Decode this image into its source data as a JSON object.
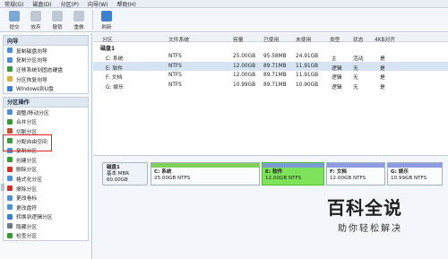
{
  "menu": [
    "常规(G)",
    "磁盘(D)",
    "分区(P)",
    "向导(W)",
    "帮助(H)"
  ],
  "toolbar": [
    {
      "label": "提交",
      "color": "#7aa7d6"
    },
    {
      "label": "放弃",
      "color": "#bfc9d6"
    },
    {
      "label": "撤销",
      "color": "#bfc9d6"
    },
    {
      "label": "重做",
      "color": "#bfc9d6"
    },
    {
      "label": "刷新",
      "color": "#3f7fd0"
    }
  ],
  "wizard": {
    "title": "向导",
    "items": [
      {
        "label": "复制磁盘向导",
        "icon": "copy-disk-icon",
        "color": "#4f8fd6"
      },
      {
        "label": "复制分区向导",
        "icon": "copy-partition-icon",
        "color": "#4f8fd6"
      },
      {
        "label": "迁移系统到固态硬盘",
        "icon": "migrate-icon",
        "color": "#3a9a3a"
      },
      {
        "label": "分区恢复向导",
        "icon": "recovery-icon",
        "color": "#d8b13a"
      },
      {
        "label": "Windows到U盘",
        "icon": "windows-usb-icon",
        "color": "#3a7fd0"
      }
    ]
  },
  "ops": {
    "title": "分区操作",
    "items": [
      {
        "label": "调整/移动分区",
        "icon": "resize-icon",
        "color": "#4f8fd6"
      },
      {
        "label": "合并分区",
        "icon": "merge-icon",
        "color": "#3a9a3a"
      },
      {
        "label": "切割分区",
        "icon": "split-icon",
        "color": "#c2522e"
      },
      {
        "label": "分配自由空间",
        "icon": "allocate-icon",
        "color": "#3a9a3a"
      },
      {
        "label": "复制分区",
        "icon": "copy-icon",
        "color": "#4f8fd6"
      },
      {
        "label": "创建分区",
        "icon": "create-icon",
        "color": "#3a9a3a"
      },
      {
        "label": "删除分区",
        "icon": "delete-icon",
        "color": "#d0322b"
      },
      {
        "label": "格式化分区",
        "icon": "format-icon",
        "color": "#4f8fd6"
      },
      {
        "label": "擦除分区",
        "icon": "wipe-icon",
        "color": "#d0322b"
      },
      {
        "label": "更改卷标",
        "icon": "label-icon",
        "color": "#4f8fd6"
      },
      {
        "label": "更改盘符",
        "icon": "drive-letter-icon",
        "color": "#4f8fd6"
      },
      {
        "label": "转换到逻辑分区",
        "icon": "convert-icon",
        "color": "#3a7fd0"
      },
      {
        "label": "隐藏分区",
        "icon": "hide-icon",
        "color": "#6c7a8a"
      },
      {
        "label": "检查分区",
        "icon": "check-icon",
        "color": "#3a9a3a"
      }
    ]
  },
  "table": {
    "headers": [
      "分区",
      "文件系统",
      "容量",
      "已使用",
      "未使用",
      "类型",
      "状态",
      "4KB对齐"
    ],
    "disk": "磁盘1",
    "rows": [
      [
        "C: 系统",
        "NTFS",
        "25.00GB",
        "95.58MB",
        "24.91GB",
        "主",
        "活动",
        "是"
      ],
      [
        "E: 软件",
        "NTFS",
        "12.00GB",
        "89.71MB",
        "11.91GB",
        "逻辑",
        "无",
        "是"
      ],
      [
        "F: 文档",
        "NTFS",
        "12.00GB",
        "89.71MB",
        "11.91GB",
        "逻辑",
        "无",
        "是"
      ],
      [
        "G: 娱乐",
        "NTFS",
        "10.99GB",
        "89.71MB",
        "10.90GB",
        "逻辑",
        "无",
        "是"
      ]
    ]
  },
  "diskmap": {
    "disk_name": "磁盘1",
    "disk_type": "基本 MBR",
    "disk_size": "60.00GB",
    "parts": [
      {
        "name": "C: 系统",
        "info": "25.00GB NTFS"
      },
      {
        "name": "E: 软件",
        "info": "12.00GB NTFS"
      },
      {
        "name": "F: 文档",
        "info": "12.00GB NTFS"
      },
      {
        "name": "G: 娱乐",
        "info": "10.99GB NTFS"
      }
    ]
  },
  "watermark": {
    "title": "百科全说",
    "subtitle": "助你轻松解决"
  }
}
